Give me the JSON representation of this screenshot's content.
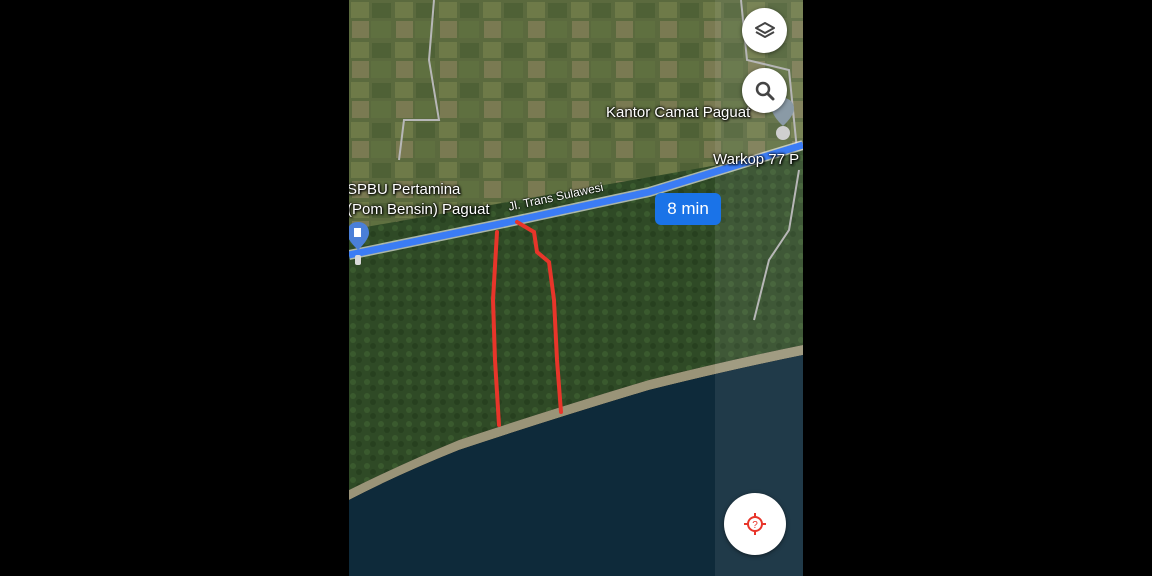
{
  "map": {
    "route_duration": "8 min",
    "places": {
      "gas_station_line1": "SPBU Pertamina",
      "gas_station_line2": "(Pom Bensin) Paguat",
      "office": "Kantor Camat Paguat",
      "cafe": "Warkop 77 P"
    },
    "road_name": "Jl. Trans Sulawesi",
    "controls": {
      "layers_icon": "layers-icon",
      "search_icon": "search-icon",
      "locate_icon": "my-location-icon"
    },
    "colors": {
      "route": "#3b7cf5",
      "duration_badge": "#1a73e8",
      "boundary_lines": "#e8352a",
      "sea": "#0e2a3a"
    }
  }
}
